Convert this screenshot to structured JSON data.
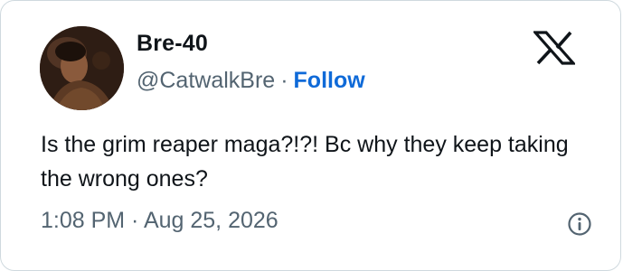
{
  "tweet": {
    "author_name": "Bre-40",
    "author_handle": "@CatwalkBre",
    "separator": "·",
    "follow_label": "Follow",
    "text": "Is the grim reaper maga?!?! Bc why they keep taking the wrong ones?",
    "timestamp": "1:08 PM · Aug 25, 2026"
  },
  "icons": {
    "brand": "x-logo-icon",
    "info": "info-icon"
  },
  "colors": {
    "text_primary": "#0f1419",
    "text_secondary": "#536471",
    "follow": "#0f6ad8",
    "border": "#cfd9de"
  }
}
